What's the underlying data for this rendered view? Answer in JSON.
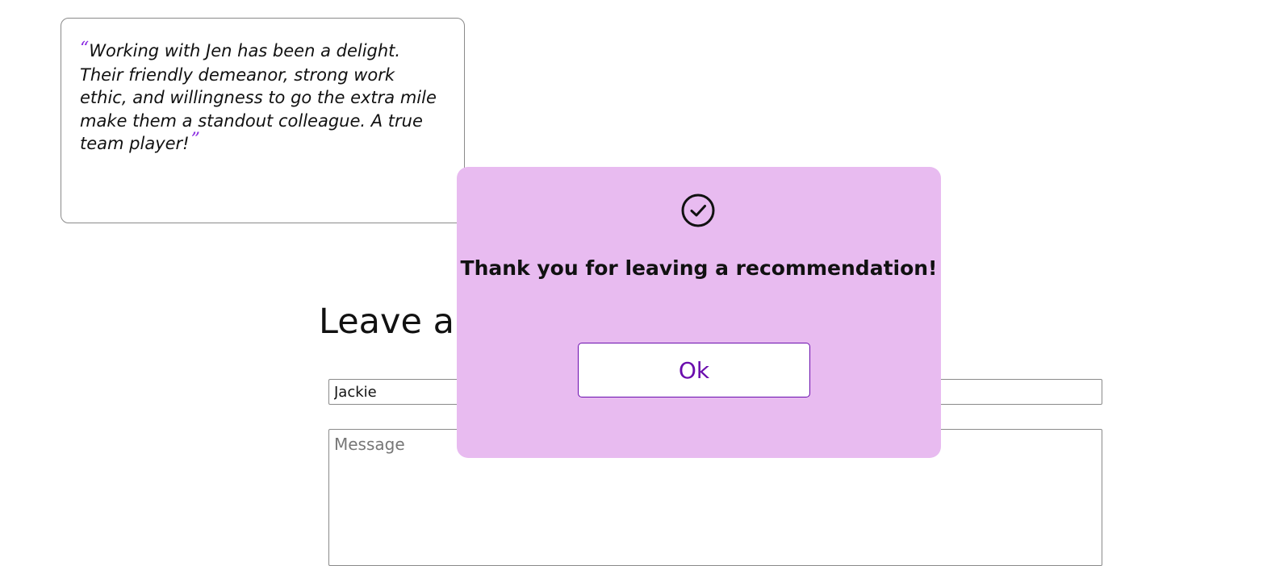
{
  "testimonial": {
    "open_quote": "“",
    "text": "Working with Jen has been a delight. Their friendly demeanor, strong work ethic, and willingness to go the extra mile make them a standout colleague. A true team player!",
    "close_quote": "”"
  },
  "form": {
    "title": "Leave a",
    "name_value": "Jackie",
    "message_placeholder": "Message"
  },
  "modal": {
    "icon": "check-circle-icon",
    "message": "Thank you for leaving a recommendation!",
    "ok_label": "Ok"
  },
  "colors": {
    "accent": "#6a0dad",
    "modal_background": "#e8bbf0",
    "quote_mark": "#8a2be2"
  }
}
